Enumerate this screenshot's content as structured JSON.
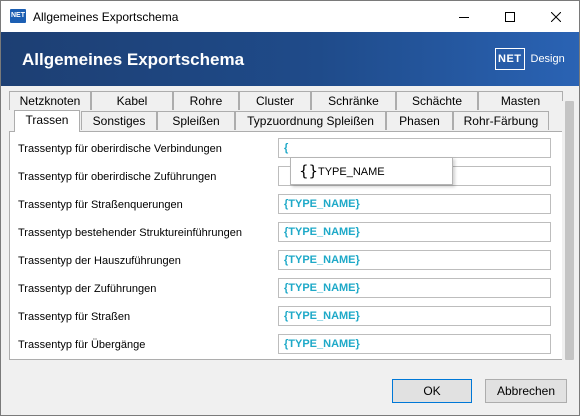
{
  "window": {
    "title": "Allgemeines Exportschema",
    "app_icon_text": "NET"
  },
  "banner": {
    "title": "Allgemeines Exportschema",
    "logo_box": "NET",
    "logo_text": "Design"
  },
  "tabs": {
    "row1": [
      "Netzknoten",
      "Kabel",
      "Rohre",
      "Cluster",
      "Schränke",
      "Schächte",
      "Masten"
    ],
    "row2": [
      "Trassen",
      "Sonstiges",
      "Spleißen",
      "Typzuordnung Spleißen",
      "Phasen",
      "Rohr-Färbung"
    ],
    "active": "Trassen"
  },
  "fields": [
    {
      "label": "Trassentyp für oberirdische Verbindungen",
      "value": "{"
    },
    {
      "label": "Trassentyp für oberirdische Zuführungen",
      "value": ""
    },
    {
      "label": "Trassentyp für Straßenquerungen",
      "value": "{TYPE_NAME}"
    },
    {
      "label": "Trassentyp bestehender Struktureinführungen",
      "value": "{TYPE_NAME}"
    },
    {
      "label": "Trassentyp der Hauszuführungen",
      "value": "{TYPE_NAME}"
    },
    {
      "label": "Trassentyp der Zuführungen",
      "value": "{TYPE_NAME}"
    },
    {
      "label": "Trassentyp für Straßen",
      "value": "{TYPE_NAME}"
    },
    {
      "label": "Trassentyp für Übergänge",
      "value": "{TYPE_NAME}"
    }
  ],
  "autocomplete": {
    "icon": "curly-braces-icon",
    "icon_glyph": "{}",
    "item": "TYPE_NAME"
  },
  "buttons": {
    "ok": "OK",
    "cancel": "Abbrechen"
  },
  "colors": {
    "banner": "#1f4b8a",
    "value_text": "#1ea9c8",
    "default_button_border": "#0078d7"
  }
}
